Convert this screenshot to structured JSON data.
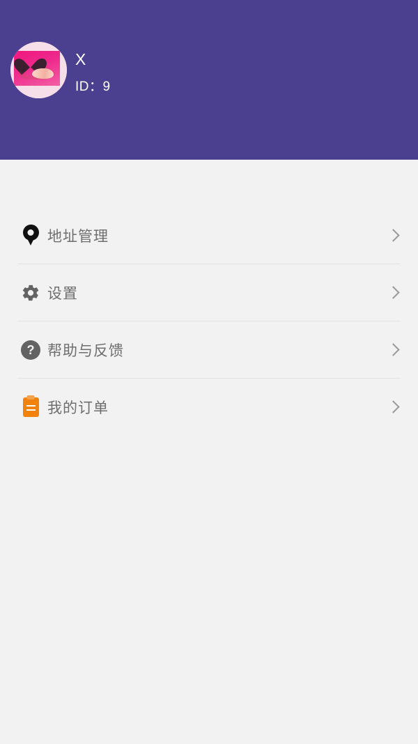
{
  "header": {
    "background_color": "#4b4090",
    "avatar": {
      "alt": "user-avatar-pink-heart-hands",
      "shape": "circle"
    },
    "username": "X",
    "user_id": "ID：9"
  },
  "page": {
    "background_color": "#f2f2f2"
  },
  "menu": {
    "items": [
      {
        "label": "地址管理",
        "icon": "location-pin-icon",
        "icon_color": "#111111",
        "chevron": "chevron-right-icon"
      },
      {
        "label": "设置",
        "icon": "gear-icon",
        "icon_color": "#636363",
        "chevron": "chevron-right-icon"
      },
      {
        "label": "帮助与反馈",
        "icon": "help-circle-icon",
        "icon_glyph": "?",
        "icon_color": "#636363",
        "chevron": "chevron-right-icon"
      },
      {
        "label": "我的订单",
        "icon": "clipboard-icon",
        "icon_color": "#f2820c",
        "chevron": "chevron-right-icon"
      }
    ]
  }
}
